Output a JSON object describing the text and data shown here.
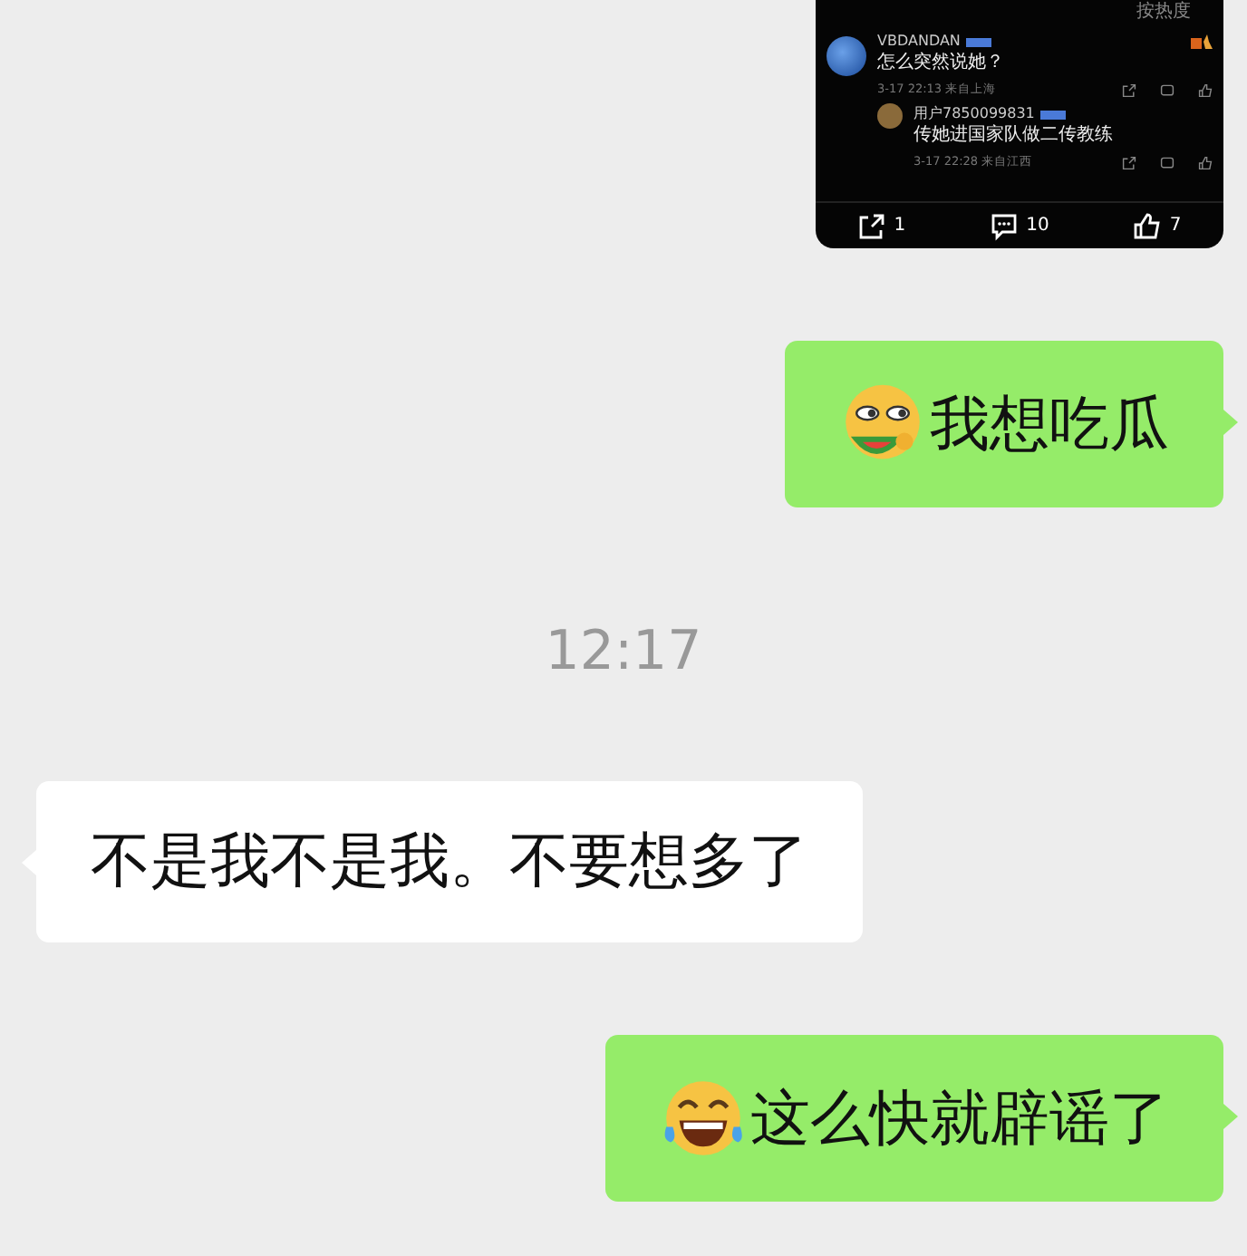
{
  "screenshot": {
    "sort_label": "按热度",
    "comments": [
      {
        "user": "VBDANDAN",
        "text": "怎么突然说她？",
        "meta": "3-17 22:13 来自上海",
        "replies": [
          {
            "user": "用户7850099831",
            "text": "传她进国家队做二传教练",
            "meta": "3-17 22:28 来自江西"
          }
        ]
      }
    ],
    "actions": [
      {
        "kind": "share",
        "count": "1"
      },
      {
        "kind": "comment",
        "count": "10"
      },
      {
        "kind": "like",
        "count": "7"
      }
    ]
  },
  "messages": [
    {
      "kind": "sent",
      "emoji": {
        "kind": "watermelon"
      },
      "text": "我想吃瓜"
    },
    {
      "kind": "time",
      "text": "12:17"
    },
    {
      "kind": "received",
      "text": "不是我不是我。不要想多了"
    },
    {
      "kind": "sent",
      "emoji": {
        "kind": "tears-of-joy"
      },
      "text": "这么快就辟谣了"
    }
  ]
}
